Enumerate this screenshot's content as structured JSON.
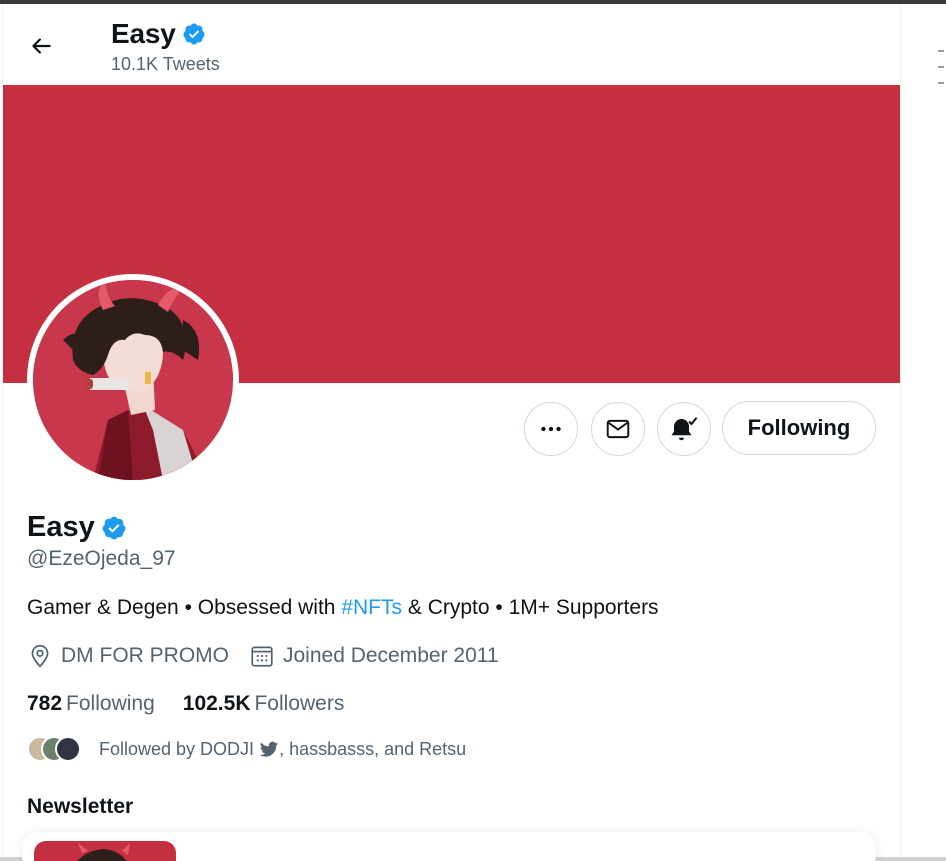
{
  "header": {
    "name": "Easy",
    "tweet_count": "10.1K Tweets"
  },
  "profile": {
    "name": "Easy",
    "handle": "@EzeOjeda_97",
    "bio": {
      "before": "Gamer & Degen • Obsessed with ",
      "hashtag": "#NFTs",
      "after": " & Crypto • 1M+ Supporters"
    },
    "location": "DM FOR PROMO",
    "joined": "Joined December 2011",
    "following_count": "782",
    "following_label": "Following",
    "followers_count": "102.5K",
    "followers_label": "Followers",
    "followed_by_prefix": "Followed by DODJI",
    "followed_by_suffix": ", hassbasss, and Retsu"
  },
  "actions": {
    "follow_button": "Following"
  },
  "sections": {
    "newsletter": "Newsletter"
  },
  "colors": {
    "banner": "#c42f42",
    "accent": "#1d9bf0",
    "secondary_text": "#536471"
  },
  "icons": {
    "back": "arrow-left-icon",
    "verified": "verified-badge-icon",
    "more": "more-horizontal-icon",
    "message": "envelope-icon",
    "notify": "bell-check-icon",
    "location": "location-pin-icon",
    "calendar": "calendar-icon",
    "twitter": "twitter-bird-icon"
  }
}
